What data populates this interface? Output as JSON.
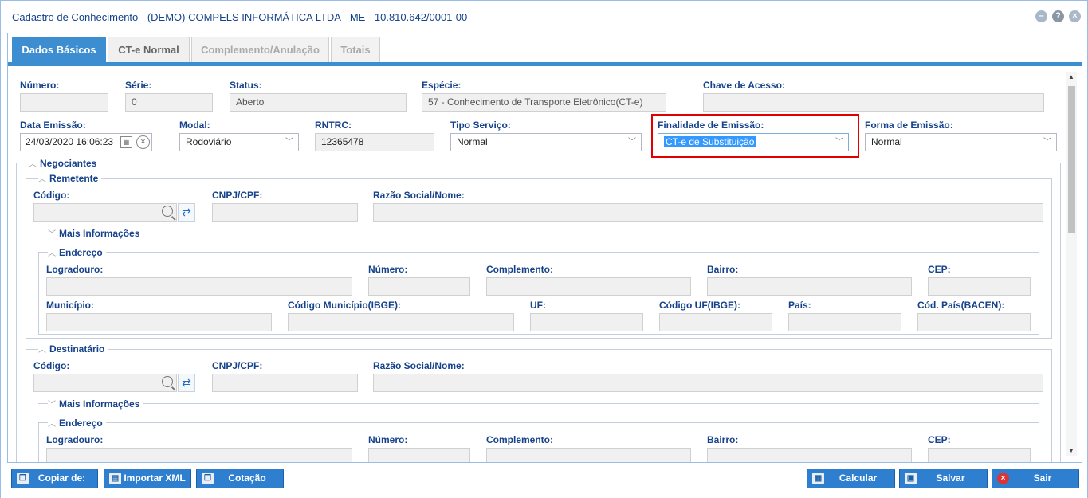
{
  "window": {
    "title": "Cadastro de Conhecimento - (DEMO) COMPELS INFORMÁTICA LTDA - ME - 10.810.642/0001-00"
  },
  "tabs": [
    {
      "label": "Dados Básicos"
    },
    {
      "label": "CT-e Normal"
    },
    {
      "label": "Complemento/Anulação"
    },
    {
      "label": "Totais"
    }
  ],
  "form": {
    "numero": {
      "label": "Número:",
      "value": ""
    },
    "serie": {
      "label": "Série:",
      "value": "0"
    },
    "status": {
      "label": "Status:",
      "value": "Aberto"
    },
    "especie": {
      "label": "Espécie:",
      "value": "57 - Conhecimento de Transporte Eletrônico(CT-e)"
    },
    "chave": {
      "label": "Chave de Acesso:",
      "value": ""
    },
    "data_emissao": {
      "label": "Data Emissão:",
      "value": "24/03/2020 16:06:23"
    },
    "modal": {
      "label": "Modal:",
      "value": "Rodoviário"
    },
    "rntrc": {
      "label": "RNTRC:",
      "value": "12365478"
    },
    "tipo_servico": {
      "label": "Tipo Serviço:",
      "value": "Normal"
    },
    "finalidade": {
      "label": "Finalidade de Emissão:",
      "value": "CT-e de Substituição"
    },
    "forma_emissao": {
      "label": "Forma de Emissão:",
      "value": "Normal"
    }
  },
  "negociantes": {
    "title": "Negociantes",
    "remetente": {
      "title": "Remetente",
      "codigo": "Código:",
      "cnpj": "CNPJ/CPF:",
      "razao": "Razão Social/Nome:",
      "mais": "Mais Informações",
      "endereco": {
        "title": "Endereço",
        "logradouro": "Logradouro:",
        "numero": "Número:",
        "complemento": "Complemento:",
        "bairro": "Bairro:",
        "cep": "CEP:",
        "municipio": "Município:",
        "cod_municipio": "Código Município(IBGE):",
        "uf": "UF:",
        "cod_uf": "Código UF(IBGE):",
        "pais": "País:",
        "cod_pais": "Cód. País(BACEN):"
      }
    },
    "destinatario": {
      "title": "Destinatário",
      "codigo": "Código:",
      "cnpj": "CNPJ/CPF:",
      "razao": "Razão Social/Nome:",
      "mais": "Mais Informações",
      "endereco": {
        "title": "Endereço",
        "logradouro": "Logradouro:",
        "numero": "Número:",
        "complemento": "Complemento:",
        "bairro": "Bairro:",
        "cep": "CEP:"
      }
    }
  },
  "buttons": {
    "copiar": "Copiar de:",
    "importar": "Importar XML",
    "cotacao": "Cotação",
    "calcular": "Calcular",
    "salvar": "Salvar",
    "sair": "Sair"
  }
}
